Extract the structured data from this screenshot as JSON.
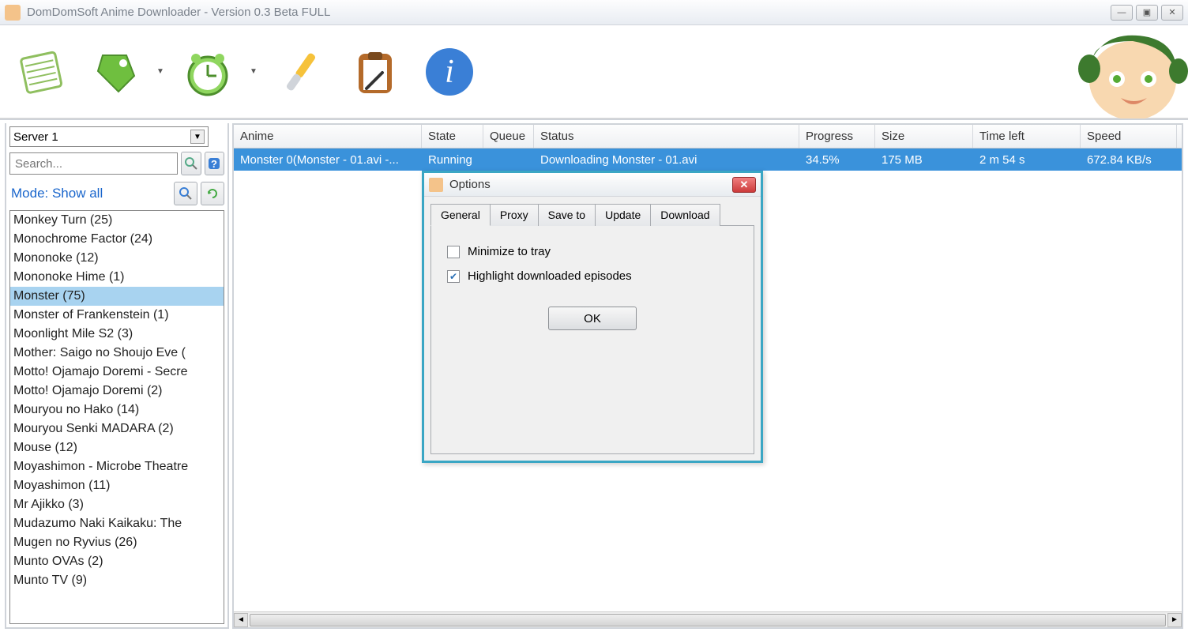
{
  "window": {
    "title": "DomDomSoft Anime Downloader - Version 0.3 Beta FULL"
  },
  "sidebar": {
    "server": "Server 1",
    "search_placeholder": "Search...",
    "mode_label": "Mode: Show all",
    "items": [
      "Monkey Turn (25)",
      "Monochrome Factor (24)",
      "Mononoke (12)",
      "Mononoke Hime (1)",
      "Monster (75)",
      "Monster of Frankenstein (1)",
      "Moonlight Mile S2 (3)",
      "Mother: Saigo no Shoujo Eve (",
      "Motto! Ojamajo Doremi - Secre",
      "Motto! Ojamajo Doremi (2)",
      "Mouryou no Hako (14)",
      "Mouryou Senki MADARA (2)",
      "Mouse (12)",
      "Moyashimon - Microbe Theatre",
      "Moyashimon (11)",
      "Mr Ajikko (3)",
      "Mudazumo Naki Kaikaku: The",
      "Mugen no Ryvius (26)",
      "Munto OVAs (2)",
      "Munto TV (9)"
    ],
    "selected_index": 4
  },
  "table": {
    "headers": {
      "anime": "Anime",
      "state": "State",
      "queue": "Queue",
      "status": "Status",
      "progress": "Progress",
      "size": "Size",
      "timeleft": "Time left",
      "speed": "Speed"
    },
    "row": {
      "anime": "Monster 0(Monster - 01.avi -...",
      "state": "Running",
      "queue": "",
      "status": "Downloading Monster - 01.avi",
      "progress": "34.5%",
      "size": "175 MB",
      "timeleft": "2 m 54 s",
      "speed": "672.84 KB/s"
    }
  },
  "dialog": {
    "title": "Options",
    "tabs": [
      "General",
      "Proxy",
      "Save to",
      "Update",
      "Download"
    ],
    "active_tab": 0,
    "opt_minimize": "Minimize to tray",
    "opt_highlight": "Highlight downloaded episodes",
    "ok": "OK"
  }
}
